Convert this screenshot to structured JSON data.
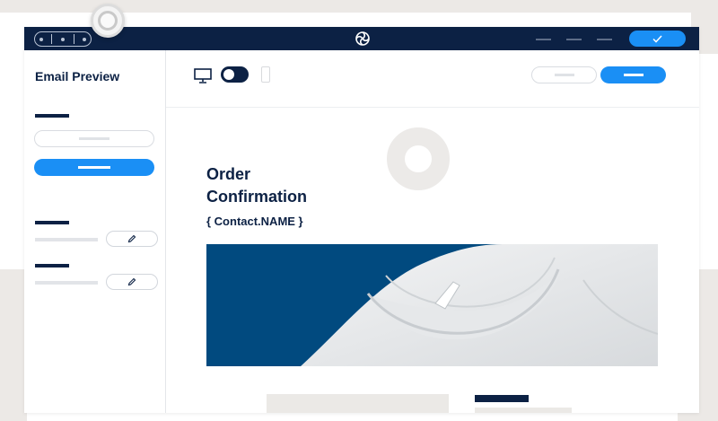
{
  "sidebar": {
    "title": "Email Preview"
  },
  "email": {
    "heading_line1": "Order",
    "heading_line2": "Confirmation",
    "contact_token": "{ Contact.NAME }"
  },
  "icons": {
    "logo": "brand-swirl-icon",
    "device_desktop": "monitor-icon",
    "device_mobile": "phone-icon",
    "edit": "pencil-icon",
    "confirm": "check-icon"
  },
  "colors": {
    "navy": "#0c2144",
    "accent_blue": "#1a8ff5",
    "hero_blue": "#014a7f"
  }
}
